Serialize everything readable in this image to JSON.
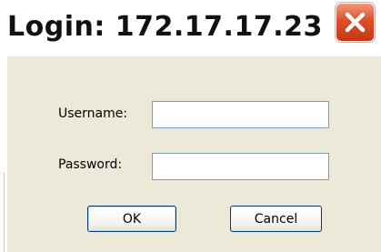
{
  "window": {
    "title": "Login: 172.17.17.23"
  },
  "form": {
    "username_label": "Username:",
    "username_value": "",
    "password_label": "Password:",
    "password_value": ""
  },
  "buttons": {
    "ok_label": "OK",
    "cancel_label": "Cancel"
  },
  "colors": {
    "dialog_background": "#ece9d8",
    "close_button": "#dc4f2a",
    "field_border": "#7f9db9",
    "button_border": "#003c74"
  },
  "icons": {
    "close": "close-icon"
  }
}
